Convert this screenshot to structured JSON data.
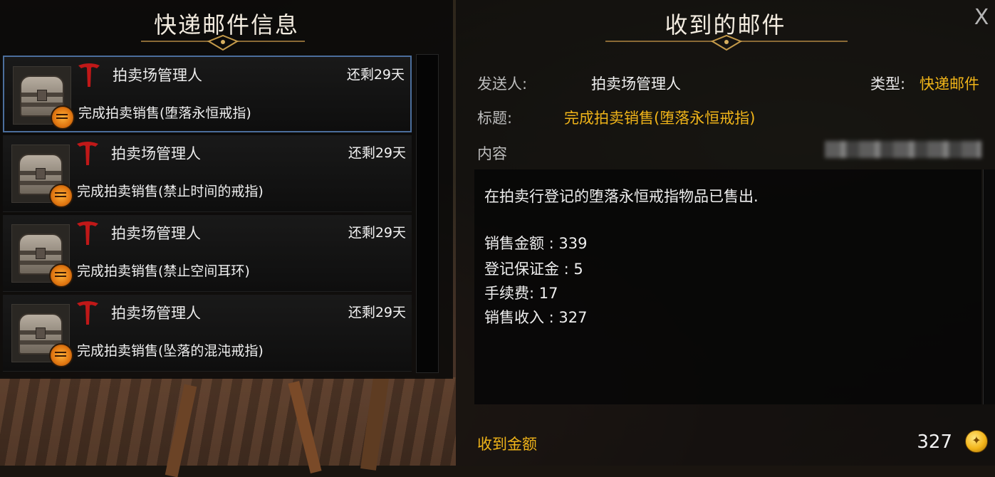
{
  "left_panel": {
    "title": "快递邮件信息",
    "mails": [
      {
        "sender": "拍卖场管理人",
        "days_left": "还剩29天",
        "subject": "完成拍卖销售(堕落永恒戒指)",
        "selected": true
      },
      {
        "sender": "拍卖场管理人",
        "days_left": "还剩29天",
        "subject": "完成拍卖销售(禁止时间的戒指)",
        "selected": false
      },
      {
        "sender": "拍卖场管理人",
        "days_left": "还剩29天",
        "subject": "完成拍卖销售(禁止空间耳环)",
        "selected": false
      },
      {
        "sender": "拍卖场管理人",
        "days_left": "还剩29天",
        "subject": "完成拍卖销售(坠落的混沌戒指)",
        "selected": false
      }
    ]
  },
  "right_panel": {
    "title": "收到的邮件",
    "close_glyph": "X",
    "sender_label": "发送人:",
    "sender_value": "拍卖场管理人",
    "type_label": "类型:",
    "type_value": "快递邮件",
    "subject_label": "标题:",
    "subject_value": "完成拍卖销售(堕落永恒戒指)",
    "content_label": "内容",
    "content_lines": [
      "在拍卖行登记的堕落永恒戒指物品已售出.",
      "销售金额 : 339",
      "登记保证金 : 5",
      "手续费: 17",
      "销售收入 : 327"
    ],
    "receive_label": "收到金额",
    "receive_amount": "327"
  },
  "colors": {
    "accent_gold": "#f0b419",
    "selected_border": "#4b6e9c",
    "panel_bg": "#0a0a0a"
  },
  "icons": {
    "mail_icon": "treasure-chest-icon",
    "sender_logo": "auction-house-logo-icon",
    "currency": "gold-coin-icon"
  }
}
